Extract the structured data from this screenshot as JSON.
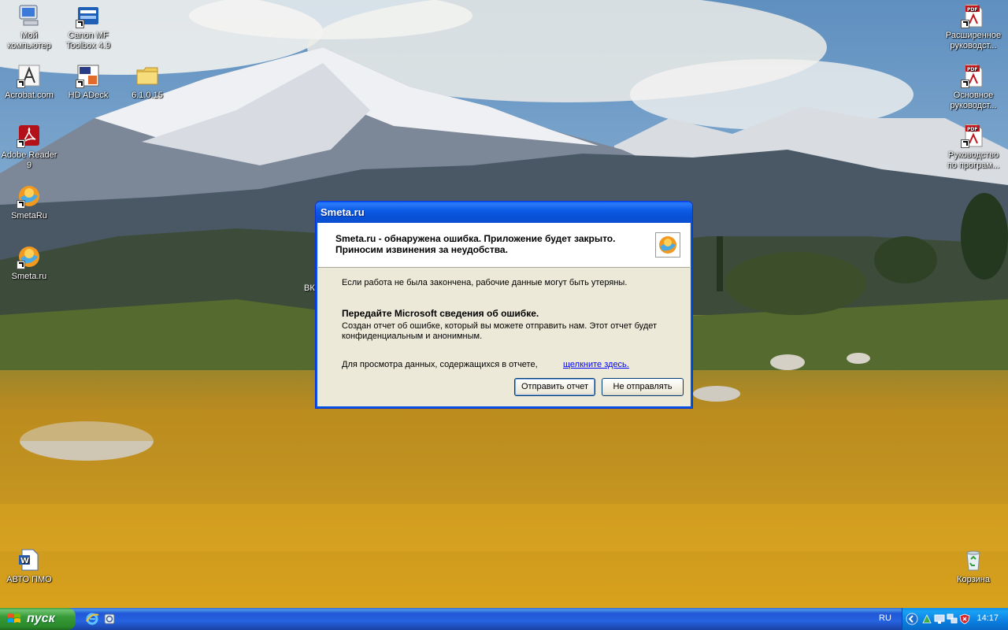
{
  "desktop": {
    "icons_left": [
      {
        "label": "Мой компьютер",
        "icon": "my-computer-icon"
      },
      {
        "label": "Canon MF Toolbox 4.9",
        "icon": "canon-toolbox-icon"
      },
      {
        "label": "Acrobat.com",
        "icon": "acrobat-com-icon"
      },
      {
        "label": "HD ADeck",
        "icon": "hd-adeck-icon"
      },
      {
        "label": "6.1.0.15",
        "icon": "folder-icon"
      },
      {
        "label": "Adobe Reader 9",
        "icon": "adobe-reader-icon"
      },
      {
        "label": "SmetaRu",
        "icon": "smetaru-icon"
      },
      {
        "label": "Smeta.ru",
        "icon": "smeta-ru-icon"
      },
      {
        "label": "АВТО ПМО",
        "icon": "word-document-icon"
      }
    ],
    "icons_right": [
      {
        "label": "Расширенное руководст...",
        "icon": "pdf-icon"
      },
      {
        "label": "Основное руководст...",
        "icon": "pdf-icon"
      },
      {
        "label": "Руководство по програм...",
        "icon": "pdf-icon"
      },
      {
        "label": "Корзина",
        "icon": "recycle-bin-icon"
      }
    ],
    "partial_label": "ВК"
  },
  "dialog": {
    "title": "Smeta.ru",
    "header_line1": "Smeta.ru - обнаружена ошибка. Приложение будет закрыто.",
    "header_line2": "Приносим извинения за неудобства.",
    "warning": "Если работа не была закончена, рабочие данные могут быть утеряны.",
    "report_heading": "Передайте Microsoft сведения об ошибке.",
    "report_text_line1": "Создан отчет об ошибке, который вы можете отправить нам. Этот отчет будет",
    "report_text_line2": "конфиденциальным и анонимным.",
    "view_data_text": "Для просмотра данных, содержащихся в отчете,",
    "view_data_link": "щелкните здесь.",
    "send_button": "Отправить отчет",
    "dont_send_button": "Не отправлять"
  },
  "taskbar": {
    "start_label": "пуск",
    "quicklaunch": [
      "internet-explorer-icon",
      "app-icon"
    ],
    "language": "RU",
    "clock": "14:17"
  },
  "colors": {
    "titlebar": "#0a5ef5",
    "taskbar": "#2663e0",
    "start_button": "#379a37",
    "tray": "#0b7fe0",
    "dialog_bg": "#ece9d8"
  }
}
